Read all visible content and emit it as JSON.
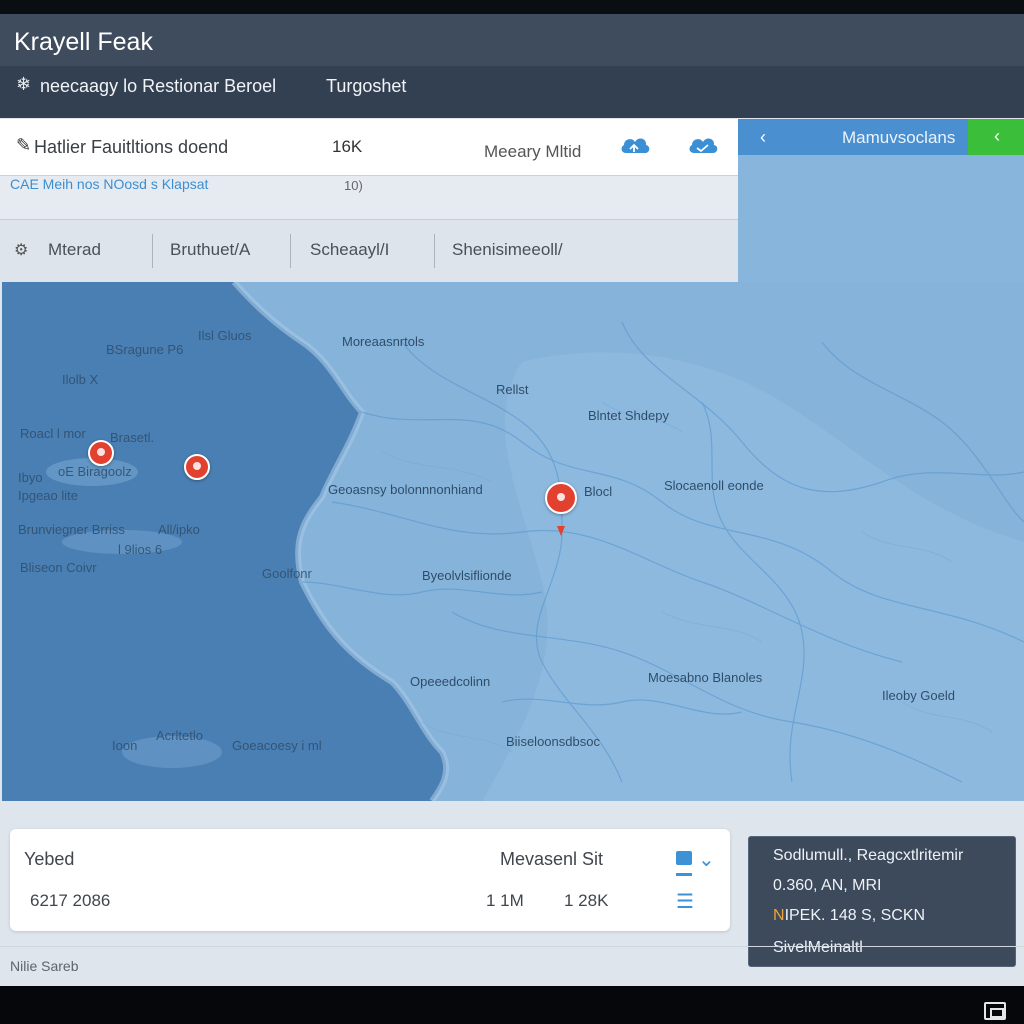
{
  "header": {
    "title": "Krayell Feak",
    "breadcrumb": "neecaagy lo Restionar Beroel",
    "link": "Turgoshet"
  },
  "search": {
    "placeholder": "Hatlier Fauitltions doend",
    "count": "16K",
    "location": "Meeary Mltid",
    "sub_text": "CAE  Meih nos  NOosd s Klapsat",
    "sub_meta": "10)"
  },
  "tabs": [
    "Mterad",
    "Bruthuet/A",
    "Scheaayl/I",
    "Shenisimeeoll/"
  ],
  "right_bar": {
    "label": "Mamuvsoclans"
  },
  "map_labels": [
    "Ilsl Gluos",
    "BSragune P6",
    "Ilolb X",
    "Roacl l mor",
    "Brasetl.",
    "Ibyo",
    "oE Biragoolz",
    "Ipgeao lite",
    "Brunviegner Brriss",
    "All/ipko",
    "l 9lios 6",
    "Bliseon Coivr",
    "Moreaasnrtols",
    "Rellst",
    "Blntet Shdepy",
    "Geoasnsy bolonnnonhiand",
    "Blocl",
    "Slocaenoll eonde",
    "Goolfonr",
    "Byeolvlsiflionde",
    "Opeeedcolinn",
    "Moesabno Blanoles",
    "Ileoby Goeld",
    "Ioon",
    "Acrltetlo",
    "Goeacoesy i ml",
    "Biiseloonsdbsoc"
  ],
  "stats": {
    "label": "Yebed",
    "value": "6217 2086",
    "mid_label": "Mevasenl Sit",
    "v1": "1 1M",
    "v2": "1 28K"
  },
  "info": {
    "line1": "Sodlumull., Reagcxtlritemir",
    "line2": "0.360, AN, MRI",
    "line3_accent": "N",
    "line3": "IPEK. 148 S, SCKN",
    "line4": "SivelMeinaltl"
  },
  "footer": "Nilie Sareb",
  "colors": {
    "titlebar": "#3e4c5e",
    "subbar": "#334051",
    "ocean": "#4a7fb3",
    "land": "#86b3da",
    "pin": "#e2412f",
    "accent_blue": "#4a90d1",
    "accent_green": "#3bbf3b"
  }
}
